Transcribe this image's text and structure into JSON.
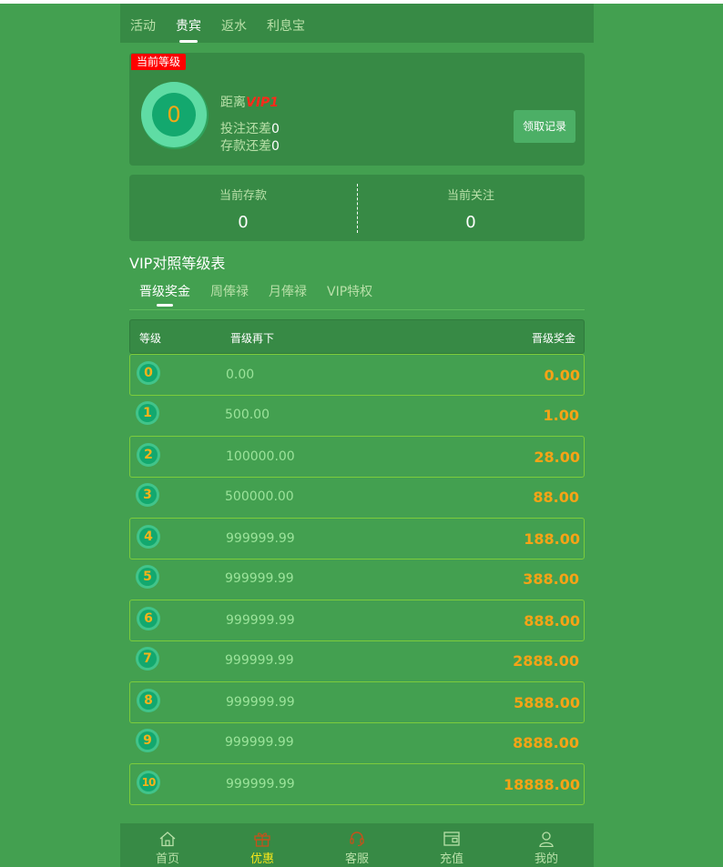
{
  "top_tabs": [
    {
      "label": "活动"
    },
    {
      "label": "贵宾"
    },
    {
      "label": "返水"
    },
    {
      "label": "利息宝"
    }
  ],
  "level_card": {
    "badge": "当前等级",
    "current_level": "0",
    "distance_prefix": "距离",
    "next_vip": "VIP1",
    "bet_label": "投注还差",
    "bet_value": "0",
    "deposit_label": "存款还差",
    "deposit_value": "0",
    "receive_button": "领取记录"
  },
  "stats": {
    "deposit_label": "当前存款",
    "deposit_value": "0",
    "follow_label": "当前关注",
    "follow_value": "0"
  },
  "vip_table_title": "VIP对照等级表",
  "sub_tabs": [
    {
      "label": "晋级奖金"
    },
    {
      "label": "周俸禄"
    },
    {
      "label": "月俸禄"
    },
    {
      "label": "VIP特权"
    }
  ],
  "table_headers": {
    "level": "等级",
    "requirement": "晋级再下",
    "bonus": "晋级奖金"
  },
  "rows": [
    {
      "level": "0",
      "requirement": "0.00",
      "bonus": "0.00"
    },
    {
      "level": "1",
      "requirement": "500.00",
      "bonus": "1.00"
    },
    {
      "level": "2",
      "requirement": "100000.00",
      "bonus": "28.00"
    },
    {
      "level": "3",
      "requirement": "500000.00",
      "bonus": "88.00"
    },
    {
      "level": "4",
      "requirement": "999999.99",
      "bonus": "188.00"
    },
    {
      "level": "5",
      "requirement": "999999.99",
      "bonus": "388.00"
    },
    {
      "level": "6",
      "requirement": "999999.99",
      "bonus": "888.00"
    },
    {
      "level": "7",
      "requirement": "999999.99",
      "bonus": "2888.00"
    },
    {
      "level": "8",
      "requirement": "999999.99",
      "bonus": "5888.00"
    },
    {
      "level": "9",
      "requirement": "999999.99",
      "bonus": "8888.00"
    },
    {
      "level": "10",
      "requirement": "999999.99",
      "bonus": "18888.00"
    }
  ],
  "bottom_nav": [
    {
      "label": "首页",
      "icon": "home-icon"
    },
    {
      "label": "优惠",
      "icon": "gift-icon"
    },
    {
      "label": "客服",
      "icon": "headset-icon"
    },
    {
      "label": "充值",
      "icon": "wallet-icon"
    },
    {
      "label": "我的",
      "icon": "user-icon"
    }
  ],
  "colors": {
    "background": "#43a050",
    "panel": "#378a45",
    "bonus": "#f6a316",
    "badge_red": "#ff0000",
    "active_nav": "#f6e51a"
  }
}
